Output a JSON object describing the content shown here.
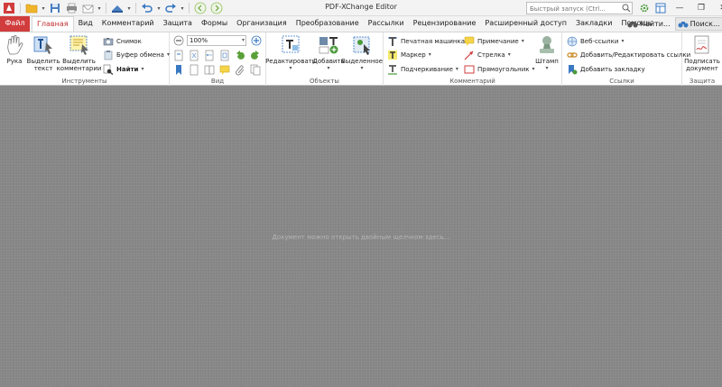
{
  "titlebar": {
    "title": "PDF-XChange Editor",
    "quick_search_placeholder": "Быстрый запуск (Ctrl...",
    "qat_icons": [
      "app-logo-icon",
      "open-folder-icon",
      "save-icon",
      "print-icon",
      "email-icon",
      "scan-icon",
      "undo-icon",
      "redo-icon",
      "back-icon",
      "forward-icon"
    ]
  },
  "tabs": {
    "file": "Файл",
    "items": [
      "Главная",
      "Вид",
      "Комментарий",
      "Защита",
      "Формы",
      "Организация",
      "Преобразование",
      "Рассылки",
      "Рецензирование",
      "Расширенный доступ",
      "Закладки",
      "Помощь"
    ],
    "active": "Главная",
    "find": "Найти...",
    "search": "Поиск..."
  },
  "ribbon": {
    "tools": {
      "label": "Инструменты",
      "hand": "Рука",
      "select_text": "Выделить текст",
      "select_comments": "Выделить комментарии",
      "snapshot": "Снимок",
      "clipboard": "Буфер обмена",
      "find": "Найти"
    },
    "view": {
      "label": "Вид",
      "zoom": "100%"
    },
    "objects": {
      "label": "Объекты",
      "edit": "Редактировать",
      "add": "Добавить",
      "selected": "Выделенное"
    },
    "comments": {
      "label": "Комментарий",
      "typewriter": "Печатная машинка",
      "note": "Примечание",
      "marker": "Маркер",
      "arrow": "Стрелка",
      "underline": "Подчеркивание",
      "rectangle": "Прямоугольник",
      "stamp": "Штамп"
    },
    "links": {
      "label": "Ссылки",
      "weblinks": "Веб-ссылки",
      "add_edit_link": "Добавить/Редактировать ссылки",
      "add_bookmark": "Добавить закладку"
    },
    "protect": {
      "label": "Защита",
      "sign": "Подписать документ"
    }
  },
  "document": {
    "hint": "Документ можно открыть двойным щелчком здесь..."
  },
  "colors": {
    "file_tab": "#d13c3c",
    "active_tab_text": "#c03131",
    "doc_bg": "#878787"
  }
}
